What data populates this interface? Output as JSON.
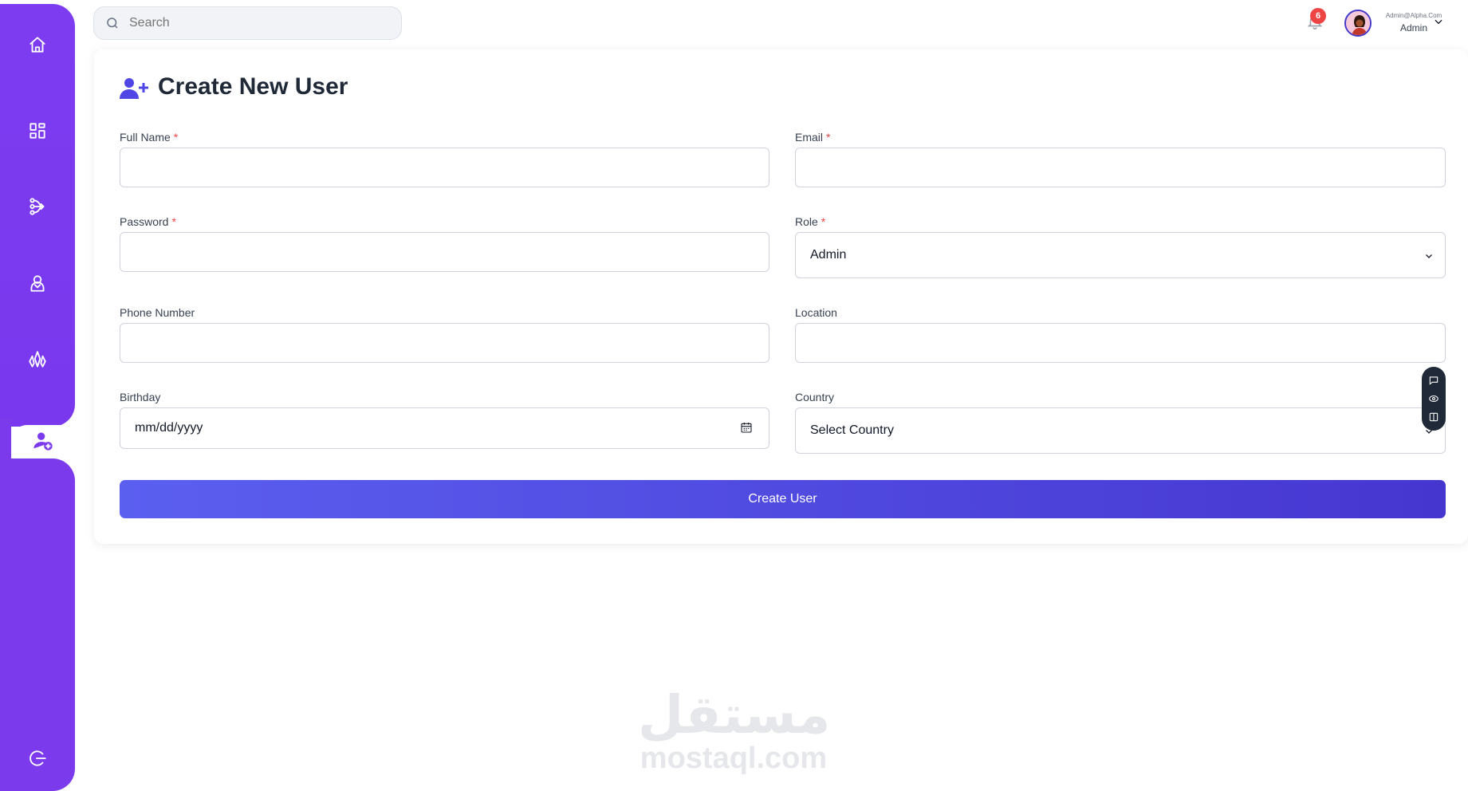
{
  "search": {
    "placeholder": "Search"
  },
  "notifications": {
    "count": "6"
  },
  "user": {
    "email": "Admin@Alpha.Com",
    "role": "Admin"
  },
  "page": {
    "title": "Create New User"
  },
  "form": {
    "full_name": {
      "label": "Full Name",
      "required": "*",
      "value": ""
    },
    "email": {
      "label": "Email",
      "required": "*",
      "value": ""
    },
    "password": {
      "label": "Password",
      "required": "*",
      "value": ""
    },
    "role": {
      "label": "Role",
      "required": "*",
      "value": "Admin"
    },
    "phone": {
      "label": "Phone Number",
      "value": ""
    },
    "location": {
      "label": "Location",
      "value": ""
    },
    "birthday": {
      "label": "Birthday",
      "placeholder": "mm/dd/yyyy"
    },
    "country": {
      "label": "Country",
      "value": "Select Country"
    },
    "submit_label": "Create User"
  },
  "sidebar": {
    "items": [
      {
        "icon": "home-icon"
      },
      {
        "icon": "dashboard-grid-icon"
      },
      {
        "icon": "branch-icon"
      },
      {
        "icon": "agent-icon"
      },
      {
        "icon": "crystal-icon"
      },
      {
        "icon": "add-user-icon",
        "active": true
      },
      {
        "icon": "logout-icon"
      }
    ]
  },
  "watermark": {
    "arabic": "مستقل",
    "latin": "mostaql.com"
  },
  "colors": {
    "sidebar": "#7c3aed",
    "accent": "#4f46e5",
    "badge": "#ef4444"
  }
}
